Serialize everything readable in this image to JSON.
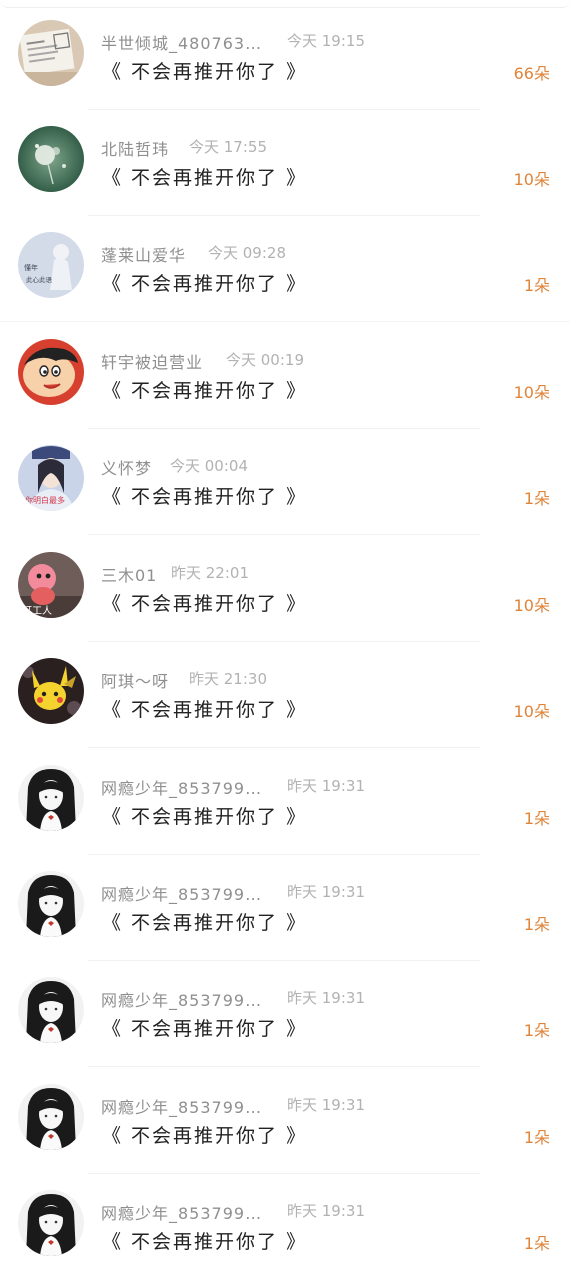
{
  "items": [
    {
      "name": "半世倾城_480763…",
      "time": "今天 19:15",
      "message": "《 不会再推开你了 》",
      "count": "66朵",
      "avatar": "newspaper-avatar-icon"
    },
    {
      "name": "北陆哲玮",
      "time": "今天 17:55",
      "message": "《 不会再推开你了 》",
      "count": "10朵",
      "avatar": "dandelion-avatar-icon"
    },
    {
      "name": "蓬莱山爱华",
      "time": "今天 09:28",
      "message": "《 不会再推开你了 》",
      "count": "1朵",
      "avatar": "girl-text-avatar-icon"
    },
    {
      "name": "轩宇被迫营业",
      "time": "今天 00:19",
      "message": "《 不会再推开你了 》",
      "count": "10朵",
      "avatar": "cartoon-boy-avatar-icon"
    },
    {
      "name": "义怀梦",
      "time": "今天 00:04",
      "message": "《 不会再推开你了 》",
      "count": "1朵",
      "avatar": "costume-girl-avatar-icon"
    },
    {
      "name": "三木01",
      "time": "昨天 22:01",
      "message": "《 不会再推开你了 》",
      "count": "10朵",
      "avatar": "pink-toy-avatar-icon"
    },
    {
      "name": "阿琪～呀",
      "time": "昨天 21:30",
      "message": "《 不会再推开你了 》",
      "count": "10朵",
      "avatar": "pikachu-avatar-icon"
    },
    {
      "name": "网瘾少年_853799…",
      "time": "昨天 19:31",
      "message": "《 不会再推开你了 》",
      "count": "1朵",
      "avatar": "anime-girl-avatar-icon"
    },
    {
      "name": "网瘾少年_853799…",
      "time": "昨天 19:31",
      "message": "《 不会再推开你了 》",
      "count": "1朵",
      "avatar": "anime-girl-avatar-icon"
    },
    {
      "name": "网瘾少年_853799…",
      "time": "昨天 19:31",
      "message": "《 不会再推开你了 》",
      "count": "1朵",
      "avatar": "anime-girl-avatar-icon"
    },
    {
      "name": "网瘾少年_853799…",
      "time": "昨天 19:31",
      "message": "《 不会再推开你了 》",
      "count": "1朵",
      "avatar": "anime-girl-avatar-icon"
    },
    {
      "name": "网瘾少年_853799…",
      "time": "昨天 19:31",
      "message": "《 不会再推开你了 》",
      "count": "1朵",
      "avatar": "anime-girl-avatar-icon"
    }
  ],
  "avatar_text": {
    "girl_text": "懂年\n此心此语",
    "costume_girl": "你明白最多",
    "pink_toy": "打工人"
  },
  "colors": {
    "accent": "#e0843a",
    "name": "#8f8f8f",
    "time": "#b2b2b2",
    "message": "#222222",
    "divider": "#f1f1f1"
  }
}
